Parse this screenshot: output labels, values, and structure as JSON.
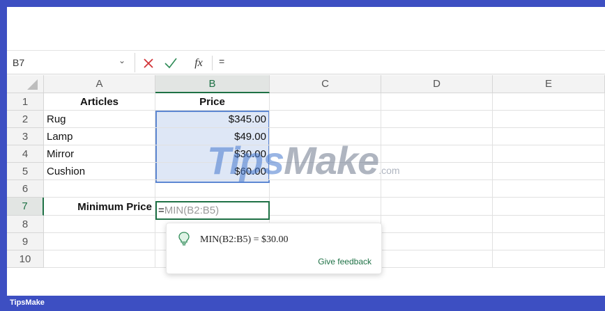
{
  "formula_bar": {
    "name_box": "B7",
    "cancel_icon": "close-icon",
    "enter_icon": "check-icon",
    "fx_label": "fx",
    "input_value": "="
  },
  "columns": [
    "A",
    "B",
    "C",
    "D",
    "E"
  ],
  "rows": [
    "1",
    "2",
    "3",
    "4",
    "5",
    "6",
    "7",
    "8",
    "9",
    "10"
  ],
  "cells": {
    "a1": "Articles",
    "b1": "Price",
    "a2": "Rug",
    "b2": "$345.00",
    "a3": "Lamp",
    "b3": "$49.00",
    "a4": "Mirror",
    "b4": "$30.00",
    "a5": "Cushion",
    "b5": "$60.00",
    "a7": "Minimum Price"
  },
  "active_cell": {
    "ref": "B7",
    "eq": "=",
    "formula_hint": "MIN(B2:B5)"
  },
  "suggestion": {
    "text": "MIN(B2:B5) = $30.00",
    "feedback_label": "Give feedback",
    "icon": "lightbulb-icon"
  },
  "watermark": {
    "main_blue": "Tips",
    "main_dark": "Make",
    "suffix": ".com"
  },
  "footer": {
    "brand": "TipsMake"
  },
  "colors": {
    "accent_green": "#1e7145",
    "selection_blue": "#5d87d2",
    "frame_blue": "#3d4fc2",
    "cancel_red": "#d13438"
  }
}
